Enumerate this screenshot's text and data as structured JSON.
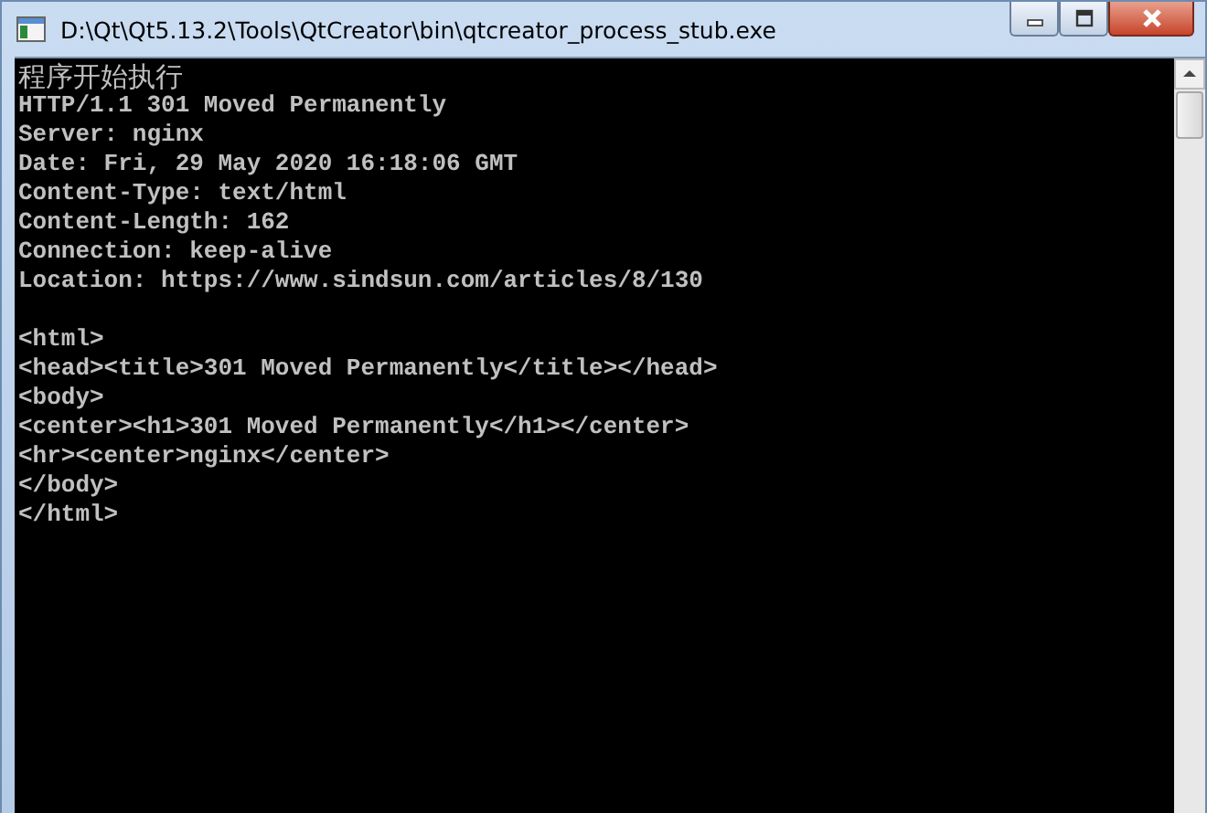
{
  "window": {
    "title": "D:\\Qt\\Qt5.13.2\\Tools\\QtCreator\\bin\\qtcreator_process_stub.exe"
  },
  "console": {
    "blocks": [
      {
        "lines": [
          "程序开始执行",
          "HTTP/1.1 301 Moved Permanently",
          "Server: nginx",
          "Date: Fri, 29 May 2020 16:18:06 GMT",
          "Content-Type: text/html",
          "Content-Length: 162",
          "Connection: keep-alive",
          "Location: https://www.sindsun.com/articles/8/130"
        ]
      },
      {
        "lines": [
          "<html>",
          "<head><title>301 Moved Permanently</title></head>",
          "<body>",
          "<center><h1>301 Moved Permanently</h1></center>",
          "<hr><center>nginx</center>",
          "</body>",
          "</html>"
        ]
      }
    ]
  }
}
